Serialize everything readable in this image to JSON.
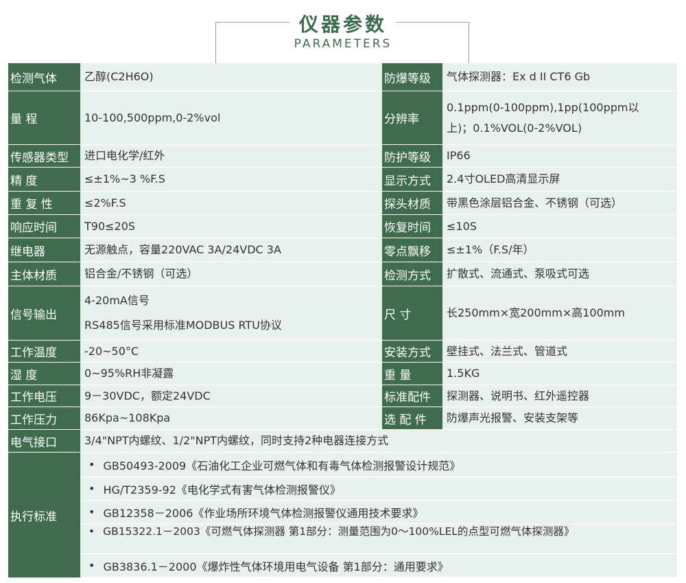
{
  "header": {
    "title": "仪器参数",
    "subtitle": "PARAMETERS"
  },
  "rows": [
    {
      "l1": "检测气体",
      "v1": "乙醇(C2H6O)",
      "l2": "防爆等级",
      "v2": "气体探测器：Ex d II CT6 Gb"
    },
    {
      "l1": "量  程",
      "v1": "10-100,500ppm,0-2%vol",
      "l2": "分辨率",
      "v2a": "0.1ppm(0-100ppm),1pp(100ppm以",
      "v2b": "上)；0.1%VOL(0-2%VOL)"
    },
    {
      "l1": "传感器类型",
      "v1": "进口电化学/红外",
      "l2": "防护等级",
      "v2": "IP66"
    },
    {
      "l1": "精  度",
      "v1": "≤±1%~3 %F.S",
      "l2": "显示方式",
      "v2": "2.4寸OLED高清显示屏"
    },
    {
      "l1": "重 复 性",
      "v1": "≤2%F.S",
      "l2": "探头材质",
      "v2": "带黑色涂层铝合金、不锈钢（可选）"
    },
    {
      "l1": "响应时间",
      "v1": "T90≤20S",
      "l2": "恢复时间",
      "v2": "≤10S"
    },
    {
      "l1": "继电器",
      "v1": "无源触点，容量220VAC 3A/24VDC 3A",
      "l2": "零点飘移",
      "v2": "≤±1%（F.S/年）"
    },
    {
      "l1": "主体材质",
      "v1": "铝合金/不锈钢（可选）",
      "l2": "检测方式",
      "v2": "扩散式、流通式、泵吸式可选"
    },
    {
      "l1": "信号输出",
      "v1a": "4-20mA信号",
      "v1b": "RS485信号采用标准MODBUS RTU协议",
      "l2": "尺  寸",
      "v2": "长250mm×宽200mm×高100mm"
    },
    {
      "l1": "工作温度",
      "v1": "-20~50°C",
      "l2": "安装方式",
      "v2": "壁挂式、法兰式、管道式"
    },
    {
      "l1": "湿  度",
      "v1": "0~95%RH非凝露",
      "l2": "重  量",
      "v2": "1.5KG"
    },
    {
      "l1": "工作电压",
      "v1": "9－30VDC，额定24VDC",
      "l2": "标准配件",
      "v2": "探测器、说明书、红外遥控器"
    },
    {
      "l1": "工作压力",
      "v1": "86Kpa~108Kpa",
      "l2": "选 配 件",
      "v2": "防爆声光报警、安装支架等"
    }
  ],
  "interface": {
    "label": "电气接口",
    "value": "3/4\"NPT内螺纹、1/2\"NPT内螺纹，同时支持2种电器连接方式"
  },
  "standards": {
    "label": "执行标准",
    "bullet": "•",
    "items": [
      "GB50493-2009《石油化工企业可燃气体和有毒气体检测报警设计规范》",
      "HG/T2359-92《电化学式有害气体检测报警仪》",
      "GB12358－2006《作业场所环境气体检测报警仪通用技术要求》",
      "GB15322.1－2003《可燃气体探测器 第1部分：测量范围为0～100%LEL的点型可燃气体探测器》",
      "GB3836.1－2000《爆炸性气体环境用电气设备 第1部分：通用要求》"
    ]
  }
}
